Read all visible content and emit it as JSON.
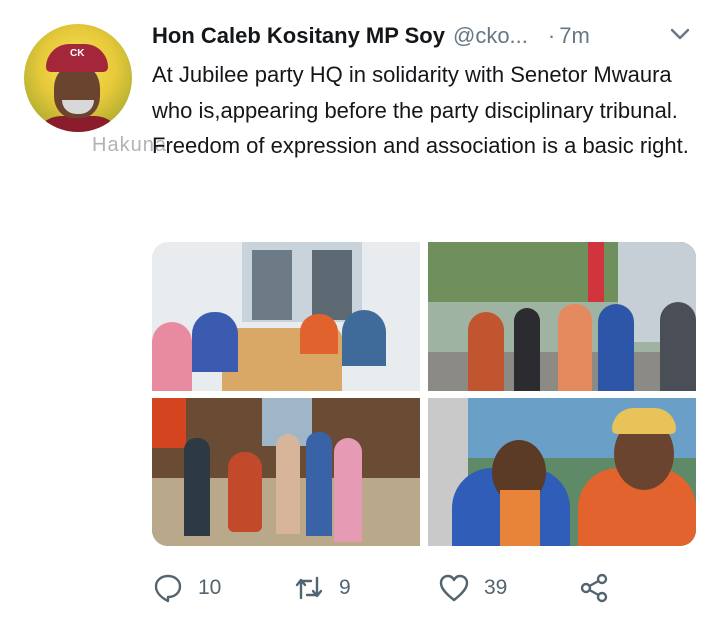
{
  "tweet": {
    "display_name": "Hon Caleb Kositany MP Soy",
    "handle": "@cko...",
    "separator": "·",
    "time": "7m",
    "text_lines": [
      "At Jubilee party HQ in solidarity with Senetor Mwaura who is,appearing before the party disciplinary tribunal.",
      "Freedom of expression and association is a basic right."
    ]
  },
  "watermark": "Hakuna",
  "avatar": {
    "cap_letters": "CK"
  },
  "media": {
    "photo_count": 4
  },
  "actions": {
    "reply_count": "10",
    "retweet_count": "9",
    "like_count": "39"
  },
  "icons": {
    "menu": "chevron-down-icon",
    "reply": "reply-icon",
    "retweet": "retweet-icon",
    "like": "heart-icon",
    "share": "share-icon"
  },
  "colors": {
    "text": "#14171a",
    "secondary": "#657786",
    "icon": "#536471"
  }
}
